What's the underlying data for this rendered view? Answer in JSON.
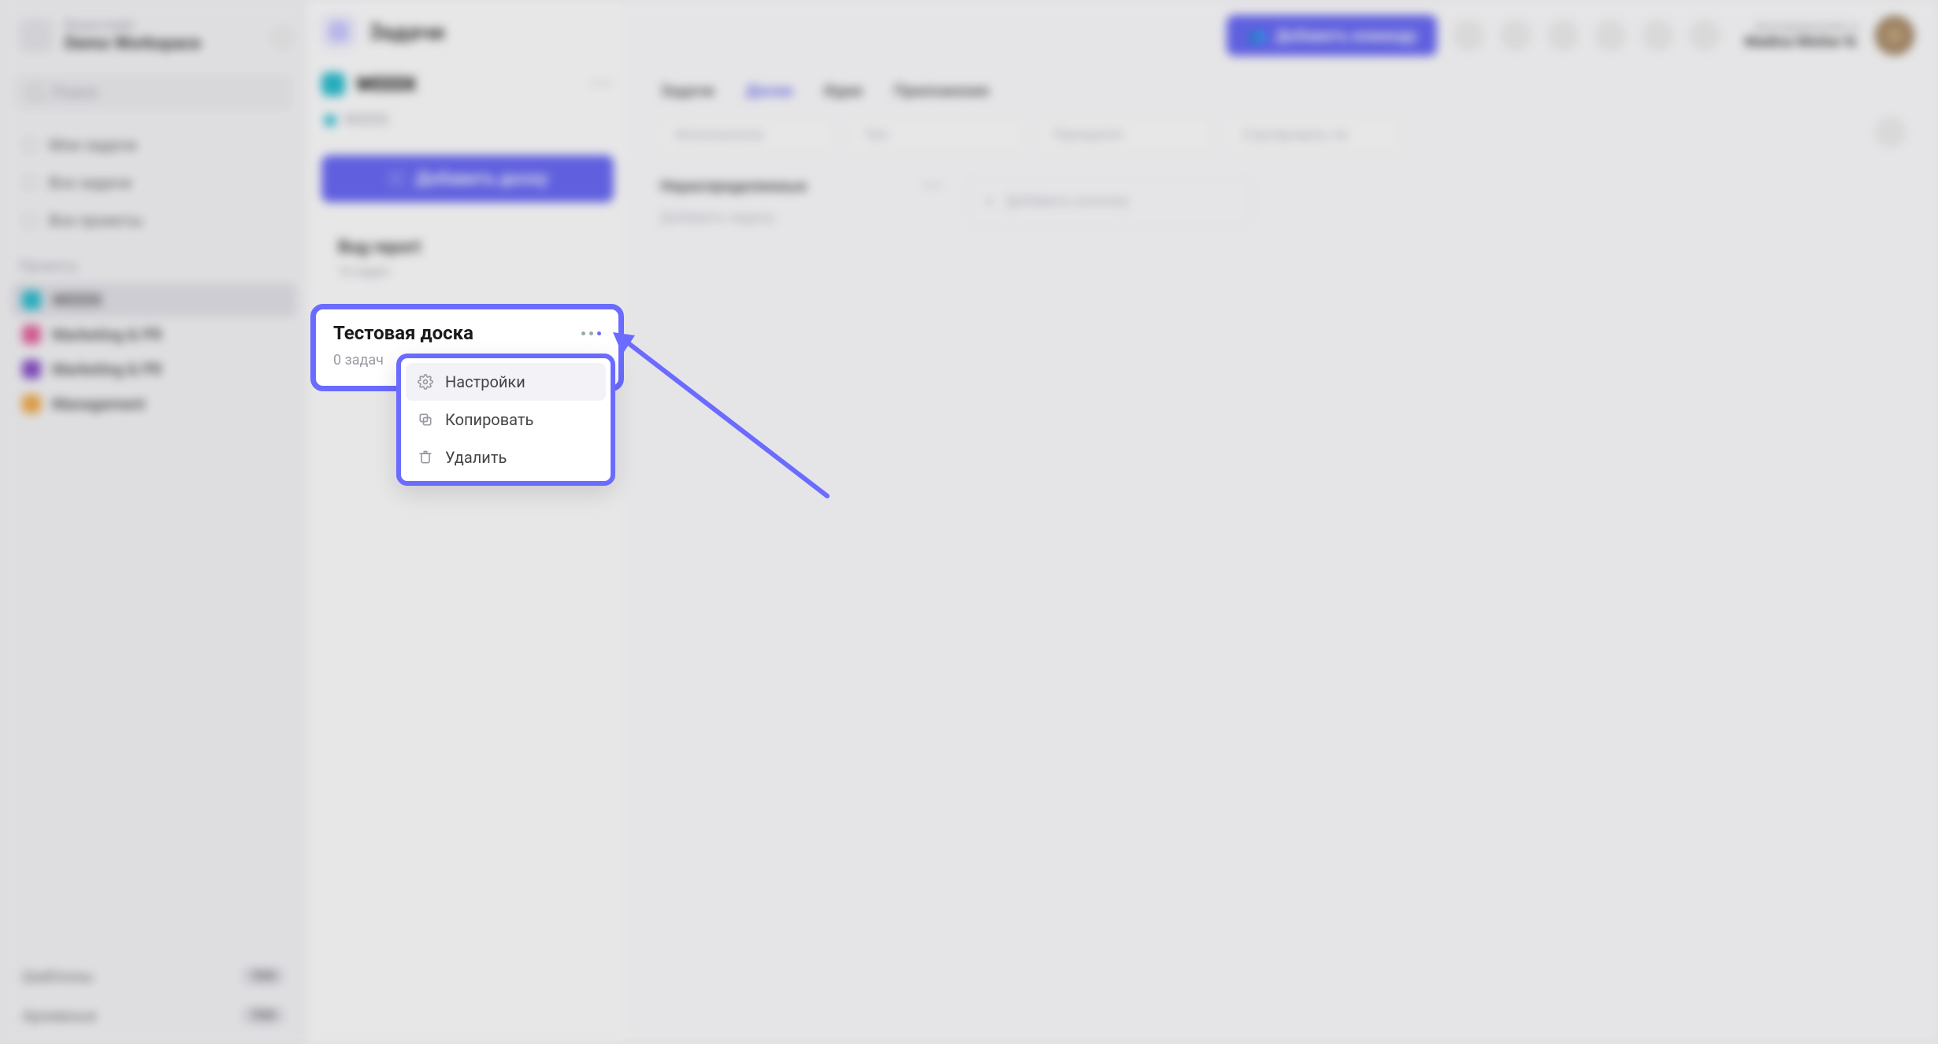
{
  "workspace": {
    "label": "Воркспейс",
    "name": "Demo Workspace"
  },
  "search": {
    "placeholder": "Поиск"
  },
  "nav": {
    "items": [
      {
        "label": "Мои задачи"
      },
      {
        "label": "Все задачи"
      },
      {
        "label": "Все проекты"
      }
    ]
  },
  "projects": {
    "heading": "Проекты",
    "items": [
      {
        "label": "WEEEK",
        "color": "#14b8cc",
        "active": true
      },
      {
        "label": "Marketing & PR",
        "color": "#e0538f"
      },
      {
        "label": "Marketing & PR",
        "color": "#7c3fbf"
      },
      {
        "label": "Management",
        "color": "#f2a23a"
      }
    ]
  },
  "sidebar_bottom": {
    "templates": {
      "label": "Шаблоны",
      "badge": "7000"
    },
    "archive": {
      "label": "Архивные",
      "badge": "7000"
    }
  },
  "boards_panel": {
    "title": "Задачи",
    "project_name": "WEEEK",
    "breadcrumb": "WEEEK",
    "add_board": "Добавить доску",
    "boards": [
      {
        "title": "Bug report",
        "sub": "16 задач"
      },
      {
        "title": "Тестовая доска",
        "sub": "0 задач"
      }
    ]
  },
  "topbar": {
    "invite": "Добавить команду",
    "user_name": "Madina-Misher N.",
    "user_email": "demo@getweeek.ru"
  },
  "tabs": {
    "items": [
      "Задачи",
      "Доски",
      "Идеи",
      "Приложения"
    ],
    "active": "Доски"
  },
  "filters": {
    "items": [
      "Исполнители",
      "Тип",
      "Приоритет",
      "Сортировать по"
    ]
  },
  "kanban": {
    "columns": [
      {
        "title": "Нераспределенные",
        "add_card": "Добавить задачу"
      }
    ],
    "add_column": "Добавить колонку"
  },
  "highlight": {
    "title": "Тестовая доска",
    "sub": "0 задач"
  },
  "context_menu": {
    "items": [
      {
        "key": "settings",
        "label": "Настройки"
      },
      {
        "key": "copy",
        "label": "Копировать"
      },
      {
        "key": "delete",
        "label": "Удалить"
      }
    ]
  },
  "colors": {
    "accent": "#6b6bff"
  }
}
